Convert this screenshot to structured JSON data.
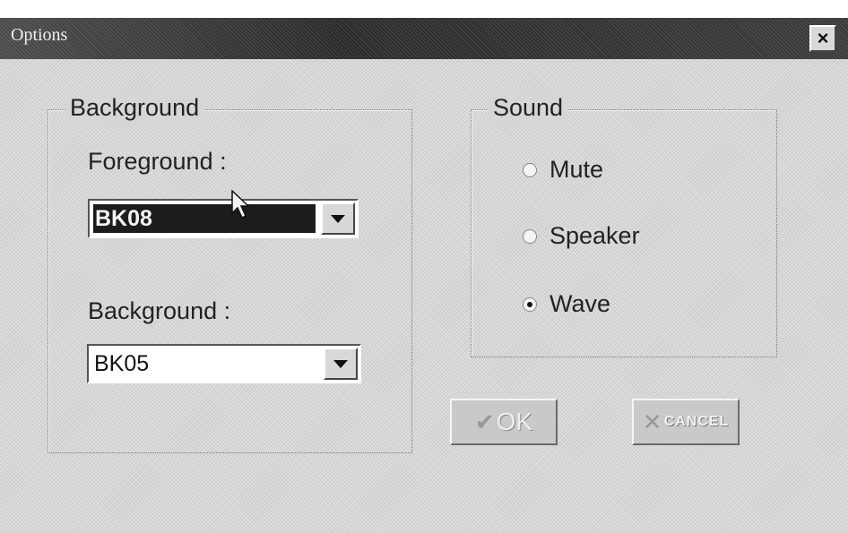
{
  "window": {
    "title": "Options",
    "close_symbol": "×"
  },
  "background_group": {
    "legend": "Background",
    "foreground": {
      "label": "Foreground :",
      "value": "BK08"
    },
    "background": {
      "label": "Background :",
      "value": "BK05"
    }
  },
  "sound_group": {
    "legend": "Sound",
    "options": [
      {
        "label": "Mute",
        "checked": false
      },
      {
        "label": "Speaker",
        "checked": false
      },
      {
        "label": "Wave",
        "checked": true
      }
    ]
  },
  "buttons": {
    "ok": {
      "icon": "✔",
      "label": "OK"
    },
    "cancel": {
      "icon": "✕",
      "label": "CANCEL"
    }
  },
  "icons": {
    "close": "close-icon",
    "dropdown": "chevron-down-icon",
    "ok": "check-icon",
    "cancel": "x-icon",
    "cursor": "mouse-pointer-icon"
  }
}
